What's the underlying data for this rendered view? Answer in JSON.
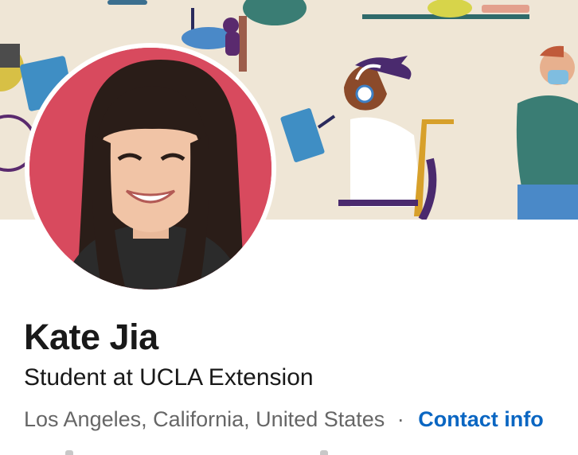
{
  "profile": {
    "name": "Kate Jia",
    "headline": "Student at UCLA Extension",
    "location": "Los Angeles, California, United States",
    "separator": "·",
    "contact_label": "Contact info"
  },
  "colors": {
    "banner_bg": "#efe6d6",
    "link": "#0a66c2",
    "name_text": "#191919",
    "secondary_text": "#666666",
    "avatar_bg": "#d84a5e"
  },
  "images": {
    "banner": "illustrated-people-working-banner",
    "avatar": "profile-photo"
  }
}
